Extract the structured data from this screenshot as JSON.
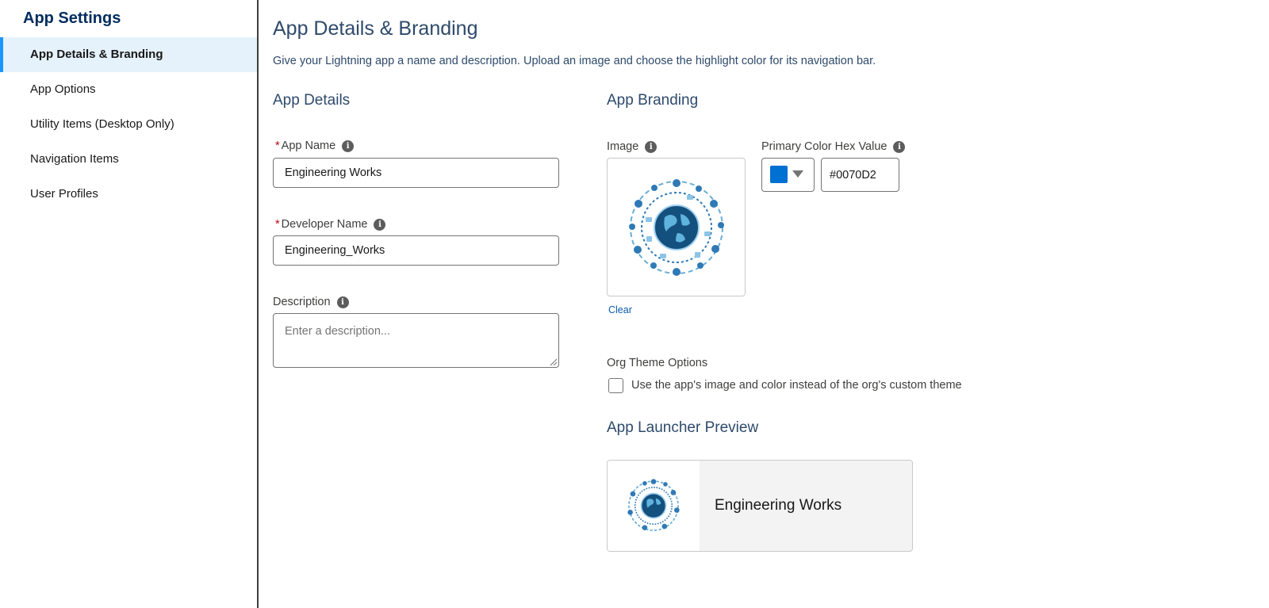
{
  "sidebar": {
    "title": "App Settings",
    "items": [
      {
        "label": "App Details & Branding",
        "active": true
      },
      {
        "label": "App Options"
      },
      {
        "label": "Utility Items (Desktop Only)"
      },
      {
        "label": "Navigation Items"
      },
      {
        "label": "User Profiles"
      }
    ]
  },
  "main": {
    "title": "App Details & Branding",
    "description": "Give your Lightning app a name and description. Upload an image and choose the highlight color for its navigation bar.",
    "details": {
      "title": "App Details",
      "app_name": {
        "label": "App Name",
        "required_mark": "*",
        "value": "Engineering Works"
      },
      "developer_name": {
        "label": "Developer Name",
        "required_mark": "*",
        "value": "Engineering_Works"
      },
      "description": {
        "label": "Description",
        "placeholder": "Enter a description..."
      }
    },
    "branding": {
      "title": "App Branding",
      "image_label": "Image",
      "clear_label": "Clear",
      "color_label": "Primary Color Hex Value",
      "color_value": "#0070D2",
      "theme_label": "Org Theme Options",
      "theme_checkbox_label": "Use the app's image and color instead of the org's custom theme",
      "theme_checked": false
    },
    "preview": {
      "title": "App Launcher Preview",
      "app_name": "Engineering Works"
    }
  },
  "icons": {
    "info": "info-icon",
    "dropdown": "chevron-down-icon",
    "app_image": "globe-technology-icon"
  },
  "colors": {
    "accent": "#1b96ff",
    "brand_primary": "#0070D2",
    "heading": "#032d60",
    "link": "#0b5cab",
    "required": "#ba0517"
  }
}
